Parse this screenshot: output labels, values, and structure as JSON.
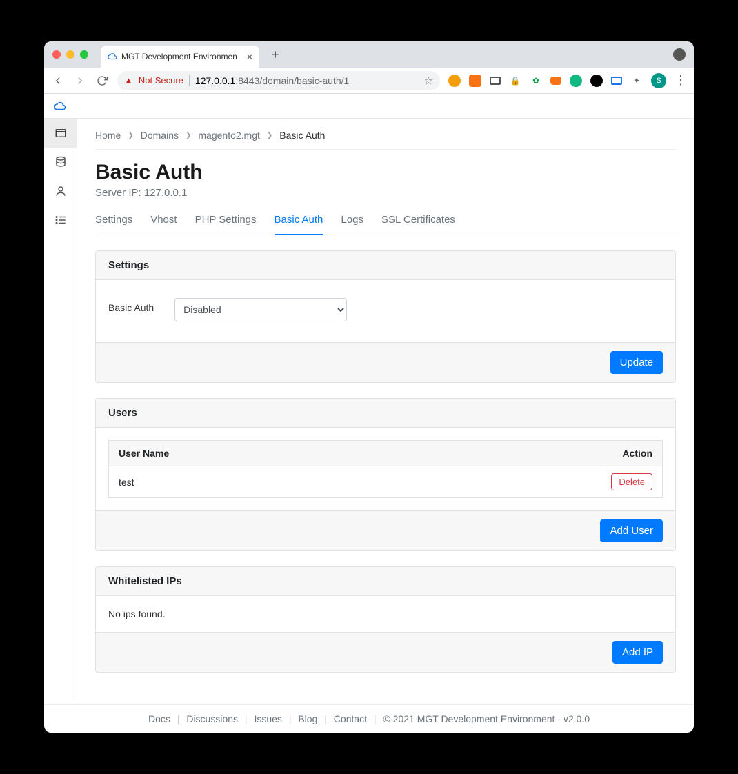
{
  "browser": {
    "tab_title": "MGT Development Environmen",
    "not_secure": "Not Secure",
    "url_host": "127.0.0.1",
    "url_port_path": ":8443/domain/basic-auth/1",
    "avatar_letter": "S"
  },
  "breadcrumb": {
    "items": [
      "Home",
      "Domains",
      "magento2.mgt"
    ],
    "current": "Basic Auth"
  },
  "page": {
    "title": "Basic Auth",
    "subtitle": "Server IP: 127.0.0.1"
  },
  "tabs": [
    {
      "label": "Settings",
      "active": false
    },
    {
      "label": "Vhost",
      "active": false
    },
    {
      "label": "PHP Settings",
      "active": false
    },
    {
      "label": "Basic Auth",
      "active": true
    },
    {
      "label": "Logs",
      "active": false
    },
    {
      "label": "SSL Certificates",
      "active": false
    }
  ],
  "settings_panel": {
    "heading": "Settings",
    "field_label": "Basic Auth",
    "select_value": "Disabled",
    "update_label": "Update"
  },
  "users_panel": {
    "heading": "Users",
    "col_user": "User Name",
    "col_action": "Action",
    "rows": [
      {
        "username": "test",
        "delete_label": "Delete"
      }
    ],
    "add_label": "Add User"
  },
  "ips_panel": {
    "heading": "Whitelisted IPs",
    "empty_text": "No ips found.",
    "add_label": "Add IP"
  },
  "footer": {
    "links": [
      "Docs",
      "Discussions",
      "Issues",
      "Blog",
      "Contact"
    ],
    "copyright": "© 2021 MGT Development Environment - v2.0.0"
  }
}
